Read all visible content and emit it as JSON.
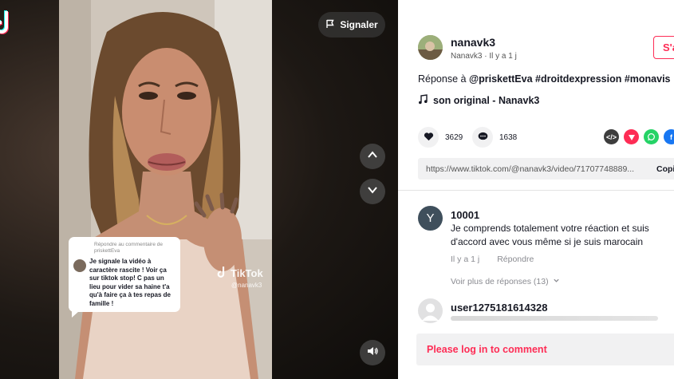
{
  "video": {
    "report_label": "Signaler",
    "reply_card": {
      "header": "Répondre au commentaire de priskettEva",
      "text": "Je signale la vidéo à caractère rascite ! Voir ça sur tiktok stop! C pas un lieu pour vider sa haine t'a qu'à faire ça à tes repas de famille !"
    },
    "watermark": {
      "brand": "TikTok",
      "user": "@nanavk3"
    }
  },
  "author": {
    "username": "nanavk3",
    "subline": "Nanavk3 · Il y a 1 j",
    "follow_label": "S'a"
  },
  "caption": {
    "prefix": "Réponse à ",
    "mention": "@priskettEva",
    "hashtags": " #droitdexpression #monavis"
  },
  "music": {
    "title": "son original - Nanavk3"
  },
  "stats": {
    "likes": "3629",
    "comments": "1638"
  },
  "share": {
    "icons": [
      {
        "name": "embed-icon",
        "color": "#3d3d3d"
      },
      {
        "name": "send-icon",
        "color": "#fe2c55"
      },
      {
        "name": "whatsapp-icon",
        "color": "#25d366"
      },
      {
        "name": "facebook-icon",
        "color": "#1877f2"
      }
    ]
  },
  "link": {
    "url": "https://www.tiktok.com/@nanavk3/video/71707748889...",
    "copy_label": "Copi"
  },
  "comments": [
    {
      "avatar_letter": "Y",
      "name": "10001",
      "text": "Je comprends totalement votre réaction et suis d'accord avec vous même si je suis marocain",
      "time": "Il y a 1 j",
      "reply_label": "Répondre",
      "more_replies": "Voir plus de réponses (13)"
    },
    {
      "name": "user1275181614328"
    }
  ],
  "login": {
    "label": "Please log in to comment"
  },
  "colors": {
    "accent": "#fe2c55",
    "text": "#161823",
    "muted": "#8a8b91",
    "bg_gray": "#f1f1f2"
  }
}
